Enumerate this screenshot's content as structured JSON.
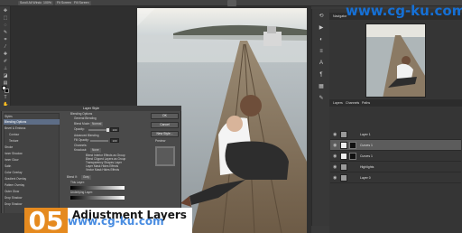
{
  "options_bar": {
    "buttons": [
      "Scroll All Windows",
      "100%",
      "Fit Screen",
      "Fill Screen"
    ]
  },
  "navigator": {
    "tab": "Navigator"
  },
  "layers": {
    "tabs": [
      "Layers",
      "Channels",
      "Paths"
    ],
    "items": [
      {
        "name": "Layer 1",
        "has_mask": false,
        "selected": false
      },
      {
        "name": "Curves 1",
        "has_mask": true,
        "selected": true
      },
      {
        "name": "Curves 1",
        "has_mask": true,
        "selected": false
      },
      {
        "name": "Highlights",
        "has_mask": false,
        "selected": false
      },
      {
        "name": "Layer 0",
        "has_mask": false,
        "selected": false
      }
    ]
  },
  "layer_style": {
    "title": "Layer Style",
    "styles": [
      "Styles",
      "Blending Options",
      "Bevel & Emboss",
      "Contour",
      "Texture",
      "Stroke",
      "Inner Shadow",
      "Inner Glow",
      "Satin",
      "Color Overlay",
      "Gradient Overlay",
      "Pattern Overlay",
      "Outer Glow",
      "Drop Shadow",
      "Drop Shadow",
      "Drop Shadow",
      "Drop Shadow"
    ],
    "active_style": "Blending Options",
    "section_title": "Blending Options",
    "general_blending": "General Blending",
    "blend_mode_label": "Blend Mode:",
    "blend_mode_value": "Normal",
    "opacity_label": "Opacity:",
    "opacity_value": "100",
    "advanced_blending": "Advanced Blending",
    "fill_opacity_label": "Fill Opacity:",
    "fill_opacity_value": "100",
    "channels_label": "Channels:",
    "knockout_label": "Knockout:",
    "knockout_value": "None",
    "checkboxes": [
      "Blend Interior Effects as Group",
      "Blend Clipped Layers as Group",
      "Transparency Shapes Layer",
      "Layer Mask Hides Effects",
      "Vector Mask Hides Effects"
    ],
    "blend_if_label": "Blend If:",
    "blend_if_value": "Gray",
    "this_layer_label": "This Layer:",
    "underlying_layer_label": "Underlying Layer:",
    "buttons": {
      "ok": "OK",
      "cancel": "Cancel",
      "new_style": "New Style...",
      "preview": "Preview"
    }
  },
  "title_card": {
    "number": "05",
    "text": "Adjustment Layers",
    "accent_color": "#e58a1f"
  },
  "watermarks": {
    "top_right": "www.cg-ku.com",
    "bottom": "www.cg-ku.com"
  }
}
